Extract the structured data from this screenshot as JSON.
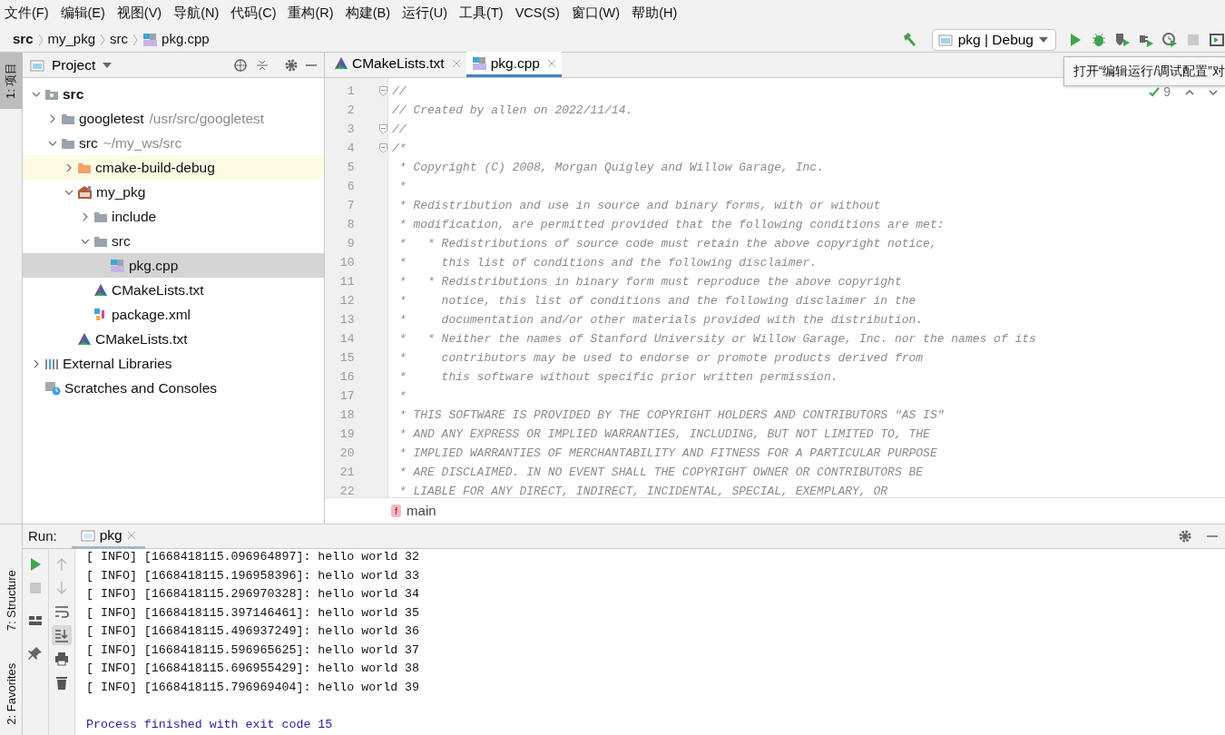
{
  "menu": [
    "文件(F)",
    "编辑(E)",
    "视图(V)",
    "导航(N)",
    "代码(C)",
    "重构(R)",
    "构建(B)",
    "运行(U)",
    "工具(T)",
    "VCS(S)",
    "窗口(W)",
    "帮助(H)"
  ],
  "breadcrumb": [
    {
      "label": "src",
      "kind": "root"
    },
    {
      "label": "my_pkg",
      "kind": "plain"
    },
    {
      "label": "src",
      "kind": "plain"
    },
    {
      "label": "pkg.cpp",
      "kind": "cpp"
    }
  ],
  "run_toolbar": {
    "config": "pkg | Debug",
    "buttons": [
      {
        "kind": "run",
        "disabled": false
      },
      {
        "kind": "debug",
        "disabled": false
      },
      {
        "kind": "coverage",
        "disabled": false
      },
      {
        "kind": "profile",
        "disabled": false
      },
      {
        "kind": "timer",
        "disabled": false
      },
      {
        "kind": "stop",
        "disabled": true
      },
      {
        "kind": "screen",
        "disabled": false
      }
    ]
  },
  "tooltip": "打开“编辑运行/调试配置”对",
  "side_tabs_top": [
    {
      "label": "1: 项目",
      "selected": true
    }
  ],
  "side_tabs_bottom": [
    {
      "label": "7: Structure",
      "selected": false
    },
    {
      "label": "2: Favorites",
      "selected": false
    }
  ],
  "project_panel": {
    "title": "Project",
    "tree": [
      {
        "label": "src",
        "kind": "module",
        "bold": true,
        "expanded": true,
        "selected": false,
        "highlighted": false,
        "children": [
          {
            "label": "googletest",
            "path": "/usr/src/googletest",
            "kind": "folder",
            "expanded": false,
            "selected": false,
            "highlighted": false
          },
          {
            "label": "src",
            "path": "~/my_ws/src",
            "kind": "folder",
            "expanded": true,
            "selected": false,
            "highlighted": false,
            "children": [
              {
                "label": "cmake-build-debug",
                "kind": "excluded",
                "expanded": false,
                "selected": false,
                "highlighted": true
              },
              {
                "label": "my_pkg",
                "kind": "package",
                "expanded": true,
                "selected": false,
                "highlighted": false,
                "children": [
                  {
                    "label": "include",
                    "kind": "folder",
                    "expanded": false,
                    "selected": false,
                    "highlighted": false
                  },
                  {
                    "label": "src",
                    "kind": "folder",
                    "expanded": true,
                    "selected": false,
                    "highlighted": false,
                    "children": [
                      {
                        "label": "pkg.cpp",
                        "kind": "cpp",
                        "selected": true,
                        "highlighted": false
                      }
                    ]
                  },
                  {
                    "label": "CMakeLists.txt",
                    "kind": "cmake",
                    "selected": false,
                    "highlighted": false
                  },
                  {
                    "label": "package.xml",
                    "kind": "xml",
                    "selected": false,
                    "highlighted": false
                  }
                ]
              },
              {
                "label": "CMakeLists.txt",
                "kind": "cmake",
                "selected": false,
                "highlighted": false
              }
            ]
          }
        ]
      },
      {
        "label": "External Libraries",
        "kind": "libraries",
        "expanded": false,
        "selected": false,
        "highlighted": false
      },
      {
        "label": "Scratches and Consoles",
        "kind": "scratches",
        "selected": false,
        "highlighted": false
      }
    ]
  },
  "editor": {
    "tabs": [
      {
        "label": "CMakeLists.txt",
        "kind": "cmake",
        "selected": false
      },
      {
        "label": "pkg.cpp",
        "kind": "cpp",
        "selected": true
      }
    ],
    "inspections": "9",
    "lines": [
      {
        "number": "1",
        "text": "//",
        "fold": true
      },
      {
        "number": "2",
        "text": "// Created by allen on 2022/11/14.",
        "fold": false
      },
      {
        "number": "3",
        "text": "//",
        "fold": true
      },
      {
        "number": "4",
        "text": "/*",
        "fold": true
      },
      {
        "number": "5",
        "text": " * Copyright (C) 2008, Morgan Quigley and Willow Garage, Inc.",
        "fold": false
      },
      {
        "number": "6",
        "text": " *",
        "fold": false
      },
      {
        "number": "7",
        "text": " * Redistribution and use in source and binary forms, with or without",
        "fold": false
      },
      {
        "number": "8",
        "text": " * modification, are permitted provided that the following conditions are met:",
        "fold": false
      },
      {
        "number": "9",
        "text": " *   * Redistributions of source code must retain the above copyright notice,",
        "fold": false
      },
      {
        "number": "10",
        "text": " *     this list of conditions and the following disclaimer.",
        "fold": false
      },
      {
        "number": "11",
        "text": " *   * Redistributions in binary form must reproduce the above copyright",
        "fold": false
      },
      {
        "number": "12",
        "text": " *     notice, this list of conditions and the following disclaimer in the",
        "fold": false
      },
      {
        "number": "13",
        "text": " *     documentation and/or other materials provided with the distribution.",
        "fold": false
      },
      {
        "number": "14",
        "text": " *   * Neither the names of Stanford University or Willow Garage, Inc. nor the names of its",
        "fold": false
      },
      {
        "number": "15",
        "text": " *     contributors may be used to endorse or promote products derived from",
        "fold": false
      },
      {
        "number": "16",
        "text": " *     this software without specific prior written permission.",
        "fold": false
      },
      {
        "number": "17",
        "text": " *",
        "fold": false
      },
      {
        "number": "18",
        "text": " * THIS SOFTWARE IS PROVIDED BY THE COPYRIGHT HOLDERS AND CONTRIBUTORS \"AS IS\"",
        "fold": false
      },
      {
        "number": "19",
        "text": " * AND ANY EXPRESS OR IMPLIED WARRANTIES, INCLUDING, BUT NOT LIMITED TO, THE",
        "fold": false
      },
      {
        "number": "20",
        "text": " * IMPLIED WARRANTIES OF MERCHANTABILITY AND FITNESS FOR A PARTICULAR PURPOSE",
        "fold": false
      },
      {
        "number": "21",
        "text": " * ARE DISCLAIMED. IN NO EVENT SHALL THE COPYRIGHT OWNER OR CONTRIBUTORS BE",
        "fold": false
      },
      {
        "number": "22",
        "text": " * LIABLE FOR ANY DIRECT, INDIRECT, INCIDENTAL, SPECIAL, EXEMPLARY, OR",
        "fold": false
      }
    ],
    "footer": {
      "badge": "f",
      "label": "main"
    }
  },
  "run_panel": {
    "title": "Run:",
    "tab": "pkg",
    "left_tools": [
      {
        "kind": "run",
        "disabled": false
      },
      {
        "kind": "stop",
        "disabled": true
      },
      {
        "kind": "layout",
        "disabled": false
      },
      {
        "kind": "pin",
        "disabled": false
      }
    ],
    "right_tools": [
      {
        "kind": "up",
        "disabled": true,
        "on": false
      },
      {
        "kind": "down",
        "disabled": true,
        "on": false
      },
      {
        "kind": "wrap",
        "disabled": false,
        "on": false
      },
      {
        "kind": "scroll-end",
        "disabled": false,
        "on": true
      },
      {
        "kind": "print",
        "disabled": false,
        "on": false
      },
      {
        "kind": "trash",
        "disabled": false,
        "on": false
      }
    ],
    "output": [
      {
        "text": "[ INFO] [1668418115.096964897]: hello world 32",
        "kind": "log"
      },
      {
        "text": "[ INFO] [1668418115.196958396]: hello world 33",
        "kind": "log"
      },
      {
        "text": "[ INFO] [1668418115.296970328]: hello world 34",
        "kind": "log"
      },
      {
        "text": "[ INFO] [1668418115.397146461]: hello world 35",
        "kind": "log"
      },
      {
        "text": "[ INFO] [1668418115.496937249]: hello world 36",
        "kind": "log"
      },
      {
        "text": "[ INFO] [1668418115.596965625]: hello world 37",
        "kind": "log"
      },
      {
        "text": "[ INFO] [1668418115.696955429]: hello world 38",
        "kind": "log"
      },
      {
        "text": "[ INFO] [1668418115.796969404]: hello world 39",
        "kind": "log"
      },
      {
        "kind": "blank"
      },
      {
        "text": "Process finished with exit code 15",
        "kind": "exit"
      }
    ]
  }
}
